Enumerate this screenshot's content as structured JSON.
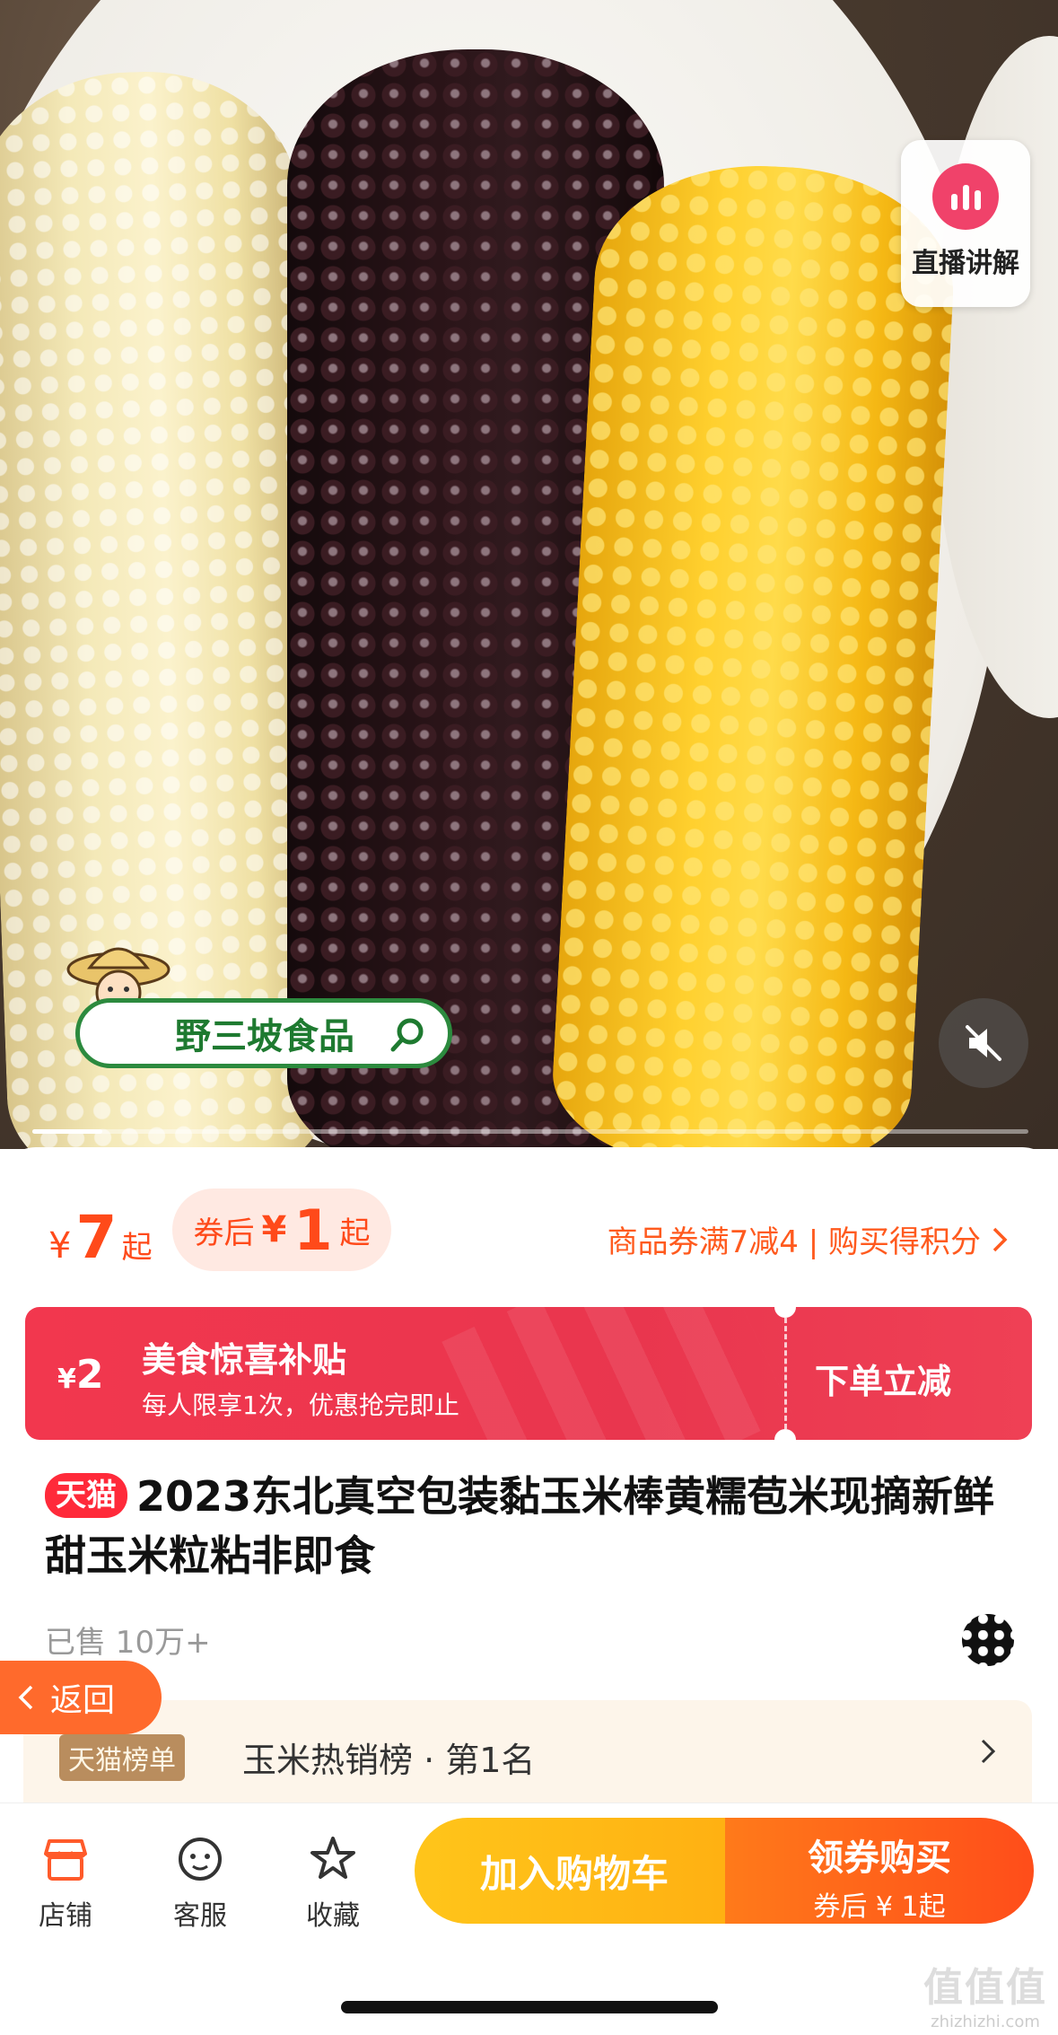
{
  "hero": {
    "live_label": "直播讲解",
    "brand_name": "野三坡食品",
    "progress": 0.07
  },
  "price": {
    "currency": "¥",
    "value": "7",
    "suffix": "起",
    "coupon_label": "券后",
    "coupon_value": "1",
    "coupon_suffix": "起",
    "promo_text": "商品券满7减4 | 购买得积分"
  },
  "subsidy": {
    "amount": "2",
    "currency": "¥",
    "title": "美食惊喜补贴",
    "subtitle": "每人限享1次，优惠抢完即止",
    "action": "下单立减"
  },
  "product": {
    "badge": "天猫",
    "title": "2023东北真空包装黏玉米棒黄糯苞米现摘新鲜甜玉米粒粘非即食",
    "sold": "已售 10万+"
  },
  "back_button": "返回",
  "rank": {
    "badge": "天猫榜单",
    "text": "玉米热销榜 · 第1名"
  },
  "bottom_bar": {
    "store": "店铺",
    "service": "客服",
    "favorite": "收藏",
    "add_cart": "加入购物车",
    "buy_title": "领券购买",
    "buy_sub": "券后 ¥ 1起"
  },
  "watermark": {
    "logo": "值值值",
    "site": "zhizhizhi.com"
  },
  "colors": {
    "price_accent": "#ff4a1a",
    "subsidy_bg": "#f2374e",
    "tmall_red": "#ff2a3a",
    "cart_yellow": "#ffc51a",
    "buy_orange": "#ff5a1a",
    "live_pink": "#f0426a"
  }
}
